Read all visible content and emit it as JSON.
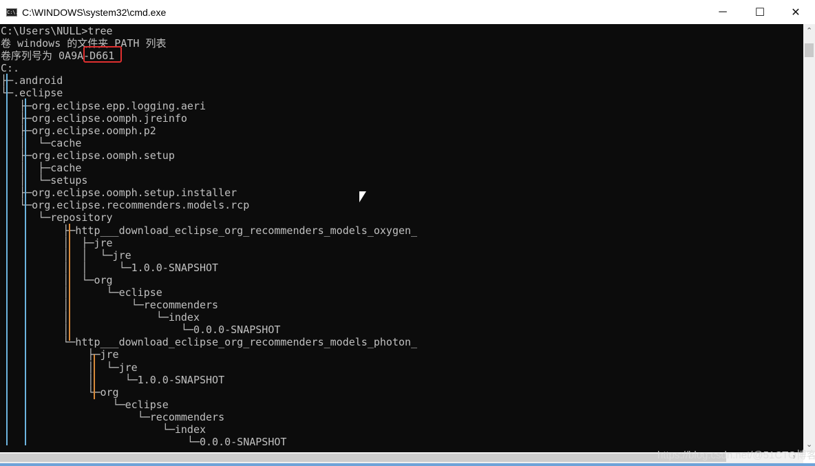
{
  "window": {
    "title": "C:\\WINDOWS\\system32\\cmd.exe",
    "app_icon": "cmd-icon",
    "app_icon_text": "C:\\."
  },
  "controls": {
    "minimize": "─",
    "maximize": "☐",
    "close": "✕"
  },
  "console": {
    "lines": [
      "C:\\Users\\NULL>tree",
      "卷 windows 的文件夹 PATH 列表",
      "卷序列号为 0A9A-D661",
      "C:.",
      "├─.android",
      "└─.eclipse",
      "   ├─org.eclipse.epp.logging.aeri",
      "   ├─org.eclipse.oomph.jreinfo",
      "   ├─org.eclipse.oomph.p2",
      "   │  └─cache",
      "   ├─org.eclipse.oomph.setup",
      "   │  ├─cache",
      "   │  └─setups",
      "   ├─org.eclipse.oomph.setup.installer",
      "   └─org.eclipse.recommenders.models.rcp",
      "      └─repository",
      "          ├─http___download_eclipse_org_recommenders_models_oxygen_",
      "          │  ├─jre",
      "          │  │  └─jre",
      "          │  │     └─1.0.0-SNAPSHOT",
      "          │  └─org",
      "          │      └─eclipse",
      "          │          └─recommenders",
      "          │              └─index",
      "          │                  └─0.0.0-SNAPSHOT",
      "          └─http___download_eclipse_org_recommenders_models_photon_",
      "              ├─jre",
      "              │  └─jre",
      "              │     └─1.0.0-SNAPSHOT",
      "              └─org",
      "                  └─eclipse",
      "                      └─recommenders",
      "                          └─index",
      "                              └─0.0.0-SNAPSHOT"
    ]
  },
  "watermark": "https://blog.csdn.net/@51CTO博客",
  "colors": {
    "console_bg": "#0c0c0c",
    "console_fg": "#c0c0c0",
    "highlight": "#e03030"
  }
}
